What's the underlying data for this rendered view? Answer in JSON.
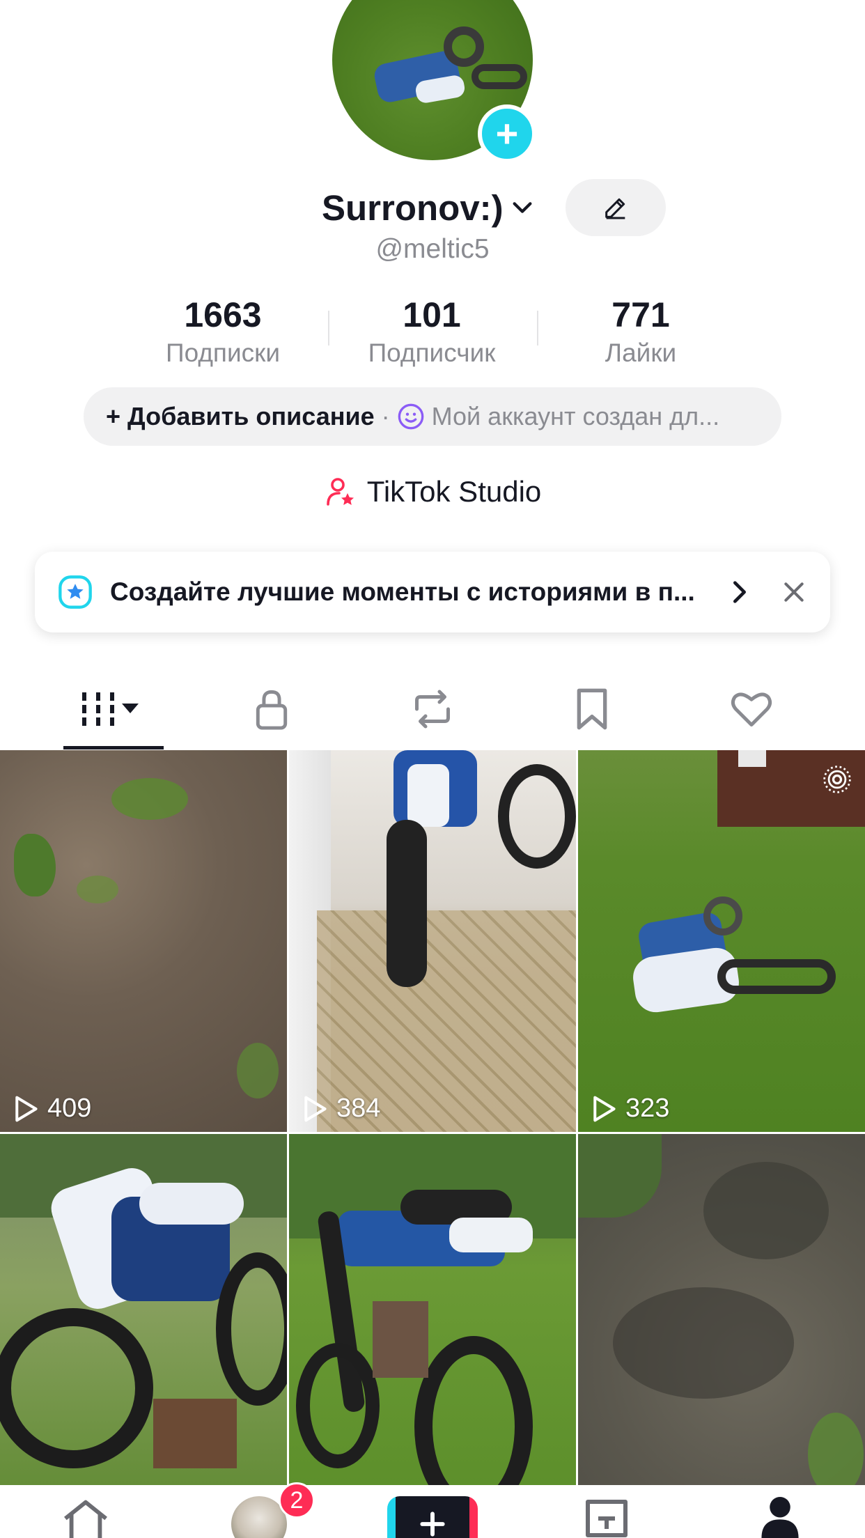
{
  "profile": {
    "display_name": "Surronov:)",
    "handle": "@meltic5",
    "stats": [
      {
        "value": "1663",
        "label": "Подписки"
      },
      {
        "value": "101",
        "label": "Подписчик"
      },
      {
        "value": "771",
        "label": "Лайки"
      }
    ],
    "add_bio_label": "+ Добавить описание",
    "bio_separator": "·",
    "bio_preview": "Мой аккаунт создан дл...",
    "studio_label": "TikTok Studio"
  },
  "banner": {
    "text": "Создайте лучшие моменты с историями в п..."
  },
  "tabs": [
    {
      "icon": "grid-icon"
    },
    {
      "icon": "lock-icon"
    },
    {
      "icon": "repost-icon"
    },
    {
      "icon": "bookmark-icon"
    },
    {
      "icon": "heart-icon"
    }
  ],
  "videos": [
    {
      "views": "409"
    },
    {
      "views": "384"
    },
    {
      "views": "323"
    },
    {
      "views": ""
    },
    {
      "views": ""
    },
    {
      "views": ""
    }
  ],
  "bottom_nav": {
    "inbox_badge": "2",
    "items": [
      "home-icon",
      "friends-avatar",
      "create-icon",
      "inbox-icon",
      "profile-icon"
    ]
  },
  "colors": {
    "accent_cyan": "#20d5ec",
    "accent_red": "#fe2c55",
    "text_primary": "#161823",
    "text_secondary": "#8a8b91"
  }
}
